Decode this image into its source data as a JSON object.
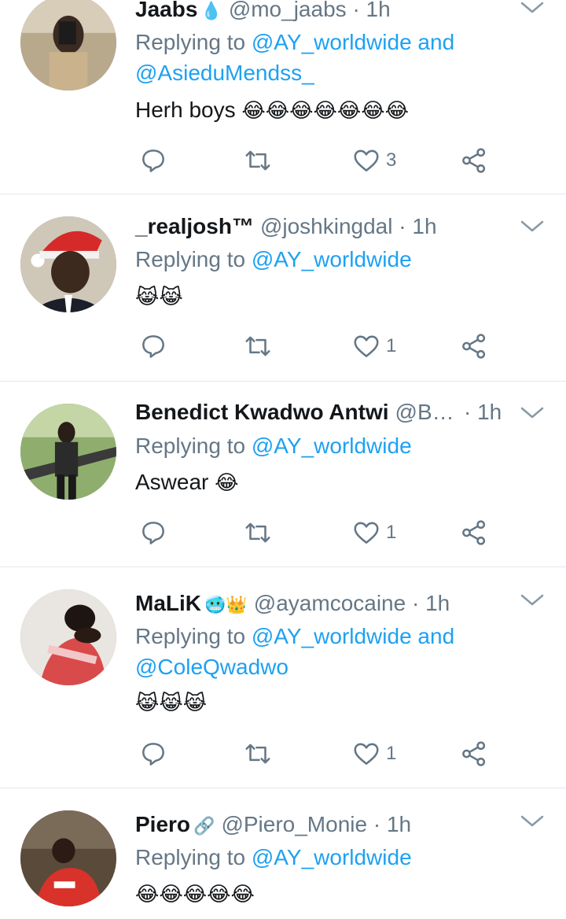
{
  "tweets": [
    {
      "name": "Jaabs",
      "badge": "💧",
      "handle": "@mo_jaabs",
      "time": "· 1h",
      "replying_prefix": "Replying to",
      "mentions_line1": "@AY_worldwide and",
      "mentions_line2": "@AsieduMendss_",
      "text": "Herh boys",
      "emoji": "😂😂😂😂😂😂😂",
      "likes": "3"
    },
    {
      "name": "_realjosh™",
      "badge": "",
      "handle": "@joshkingdal",
      "time": "· 1h",
      "replying_prefix": "Replying to",
      "mentions_line1": "@AY_worldwide",
      "mentions_line2": "",
      "text": "",
      "emoji": "😹😹",
      "likes": "1"
    },
    {
      "name": "Benedict Kwadwo Antwi",
      "badge": "",
      "handle": "@B…",
      "time": "· 1h",
      "replying_prefix": "Replying to",
      "mentions_line1": "@AY_worldwide",
      "mentions_line2": "",
      "text": "Aswear",
      "emoji": "😂",
      "likes": "1"
    },
    {
      "name": "MaLiK",
      "badge": "🥶👑",
      "handle": "@ayamcocaine",
      "time": "· 1h",
      "replying_prefix": "Replying to",
      "mentions_line1": "@AY_worldwide and",
      "mentions_line2": "@ColeQwadwo",
      "text": "",
      "emoji": "😹😹😹",
      "likes": "1"
    },
    {
      "name": "Piero",
      "badge": "🔗",
      "handle": "@Piero_Monie",
      "time": "· 1h",
      "replying_prefix": "Replying to",
      "mentions_line1": "@AY_worldwide",
      "mentions_line2": "",
      "text": "",
      "emoji": "😂😂😂😂😂",
      "likes": ""
    }
  ],
  "icons": {
    "reply": "reply-icon",
    "retweet": "retweet-icon",
    "like": "heart-icon",
    "share": "share-icon",
    "menu": "chevron-down-icon"
  },
  "colors": {
    "mention": "#1da1f2",
    "secondary_text": "#657786",
    "icon": "#657786",
    "divider": "#e1e8ed"
  }
}
